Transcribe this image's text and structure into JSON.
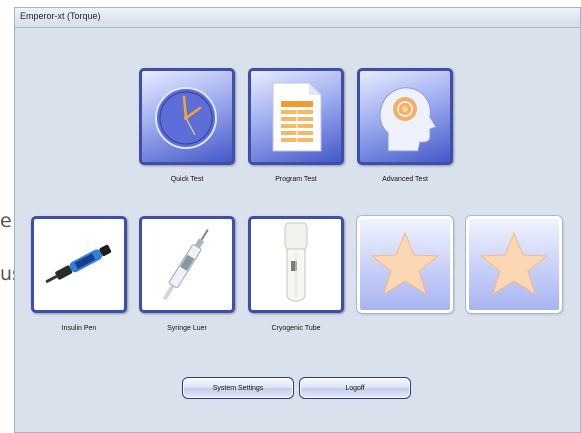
{
  "background": {
    "fragment_1": "e",
    "fragment_2": "us"
  },
  "window": {
    "title": "Emperor-xt (Torque)"
  },
  "tests": [
    {
      "label": "Quick Test",
      "icon": "clock-icon"
    },
    {
      "label": "Program Test",
      "icon": "document-icon"
    },
    {
      "label": "Advanced Test",
      "icon": "head-profile-icon"
    }
  ],
  "devices": [
    {
      "label": "Insulin Pen",
      "icon": "insulin-pen-icon"
    },
    {
      "label": "Syringe Luer",
      "icon": "syringe-icon"
    },
    {
      "label": "Cryogenic Tube",
      "icon": "cryogenic-tube-icon"
    }
  ],
  "favorites": [
    {
      "icon": "star-icon"
    },
    {
      "icon": "star-icon"
    }
  ],
  "buttons": {
    "system_settings": "System Settings",
    "logoff": "Logoff"
  },
  "colors": {
    "window_bg": "#d9e1ed",
    "tile_border": "#3e4ea9",
    "accent_orange": "#f7a23a"
  }
}
